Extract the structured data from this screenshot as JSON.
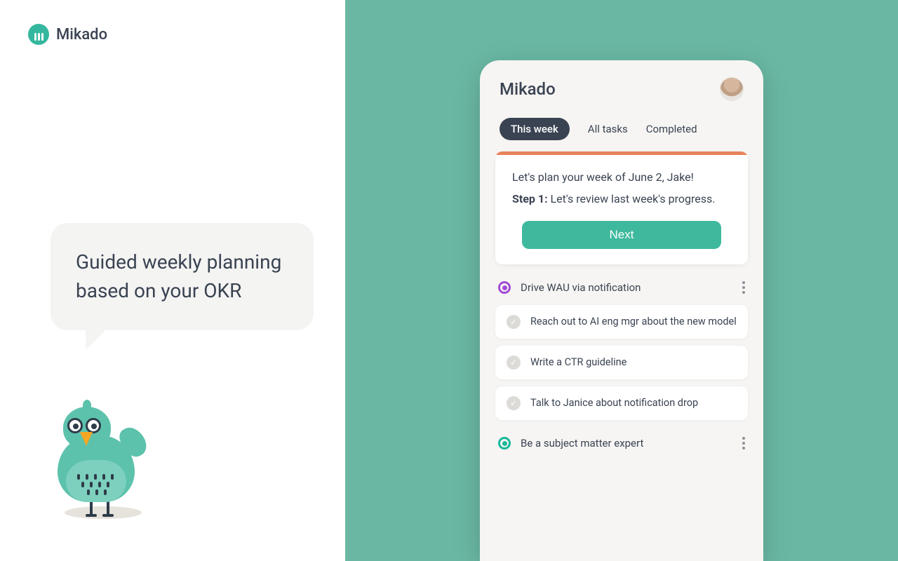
{
  "brand": {
    "name": "Mikado"
  },
  "hero": {
    "bubble_text": "Guided weekly planning based on your OKR"
  },
  "app": {
    "title": "Mikado",
    "tabs": [
      {
        "label": "This week",
        "active": true
      },
      {
        "label": "All tasks",
        "active": false
      },
      {
        "label": "Completed",
        "active": false
      }
    ],
    "plan_card": {
      "line1": "Let's plan your week of June 2,  Jake!",
      "step_label": "Step 1:",
      "step_desc": "Let's review last week's progress.",
      "next_label": "Next"
    },
    "goals": [
      {
        "color": "purple",
        "title": "Drive WAU via notification",
        "tasks": [
          "Reach out to AI eng mgr about the new model",
          "Write a CTR guideline",
          "Talk to Janice about notification drop"
        ]
      },
      {
        "color": "teal",
        "title": "Be a subject matter expert",
        "tasks": []
      }
    ]
  }
}
